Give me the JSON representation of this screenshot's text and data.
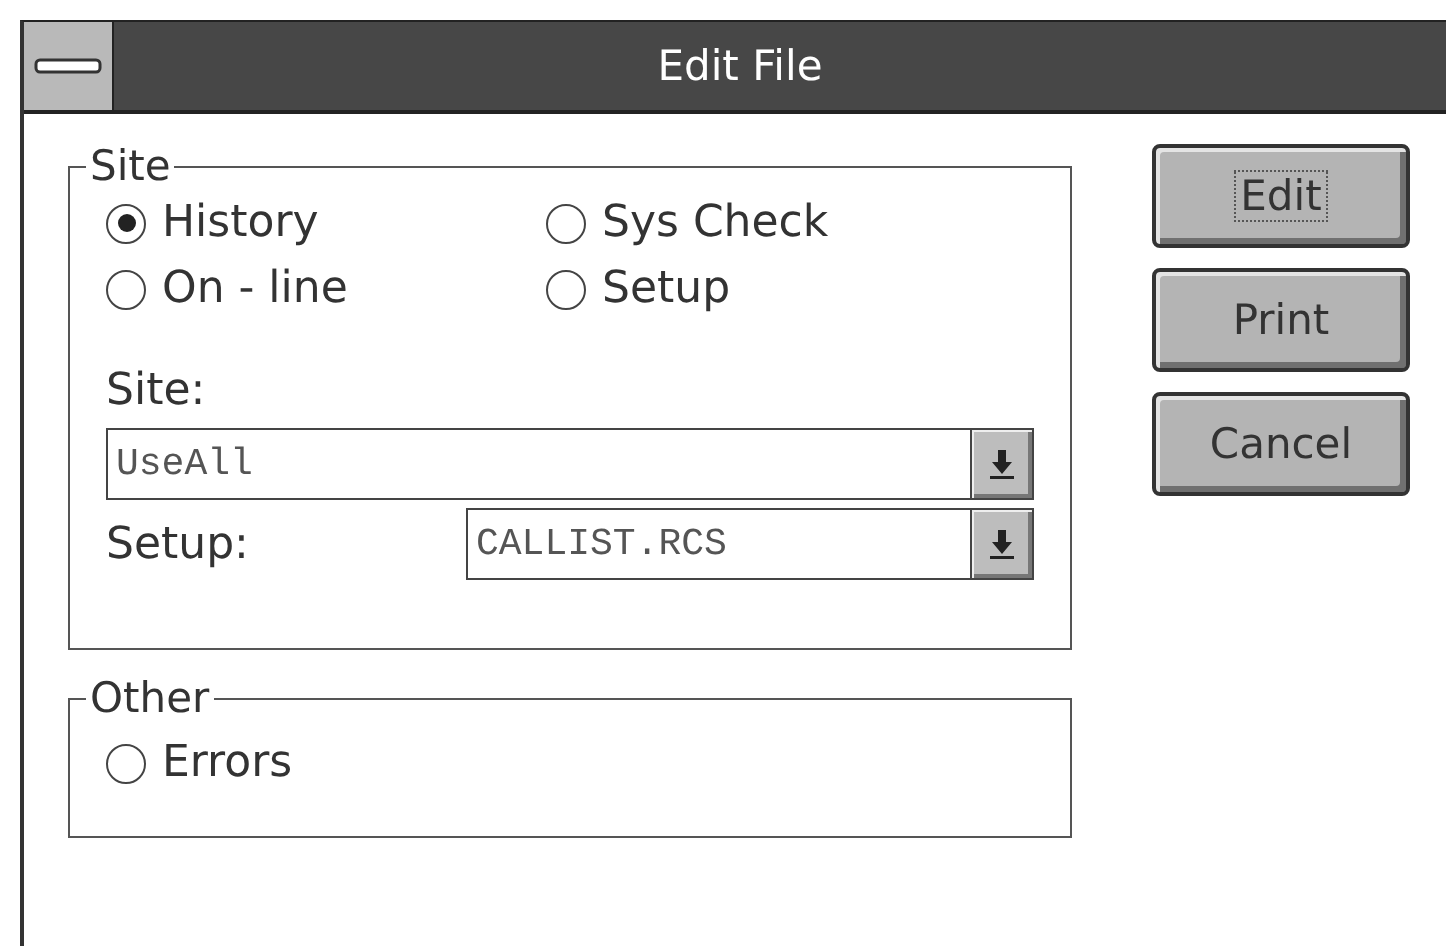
{
  "window": {
    "title": "Edit File"
  },
  "site_group": {
    "title": "Site",
    "options": [
      {
        "label": "History",
        "selected": true
      },
      {
        "label": "Sys Check",
        "selected": false
      },
      {
        "label": "On - line",
        "selected": false
      },
      {
        "label": "Setup",
        "selected": false
      }
    ],
    "site_field": {
      "label": "Site:",
      "value": "UseAll"
    },
    "setup_field": {
      "label": "Setup:",
      "value": "CALLIST.RCS"
    }
  },
  "other_group": {
    "title": "Other",
    "options": [
      {
        "label": "Errors",
        "selected": false
      }
    ]
  },
  "buttons": [
    {
      "label": "Edit",
      "focused": true
    },
    {
      "label": "Print",
      "focused": false
    },
    {
      "label": "Cancel",
      "focused": false
    }
  ]
}
